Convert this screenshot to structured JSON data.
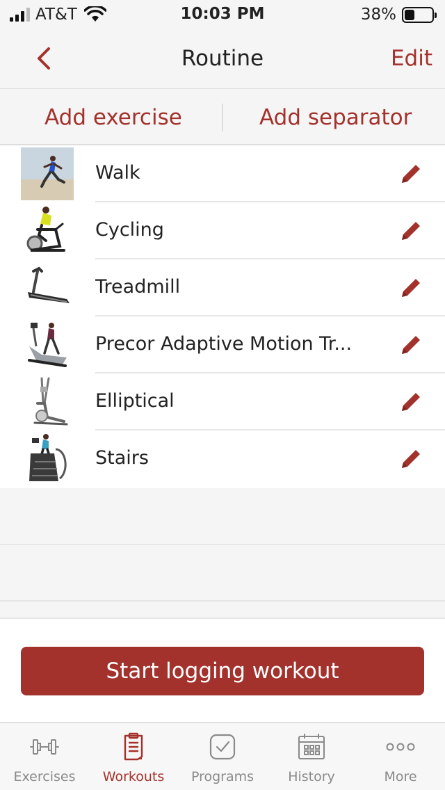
{
  "status_bar": {
    "carrier": "AT&T",
    "time": "10:03 PM",
    "battery": "38%",
    "battery_level": 0.38
  },
  "nav": {
    "title": "Routine",
    "edit_label": "Edit"
  },
  "actions": {
    "add_exercise": "Add exercise",
    "add_separator": "Add separator"
  },
  "exercises": [
    {
      "name": "Walk",
      "thumb": "runner-photo"
    },
    {
      "name": "Cycling",
      "thumb": "spin-bike-photo"
    },
    {
      "name": "Treadmill",
      "thumb": "treadmill-photo"
    },
    {
      "name": "Precor Adaptive Motion Tr...",
      "thumb": "adaptive-motion-trainer-photo"
    },
    {
      "name": "Elliptical",
      "thumb": "elliptical-photo"
    },
    {
      "name": "Stairs",
      "thumb": "stair-climber-photo"
    }
  ],
  "start_button": "Start logging workout",
  "tabs": [
    {
      "label": "Exercises",
      "icon": "dumbbell-icon"
    },
    {
      "label": "Workouts",
      "icon": "clipboard-icon"
    },
    {
      "label": "Programs",
      "icon": "checkbox-icon"
    },
    {
      "label": "History",
      "icon": "calendar-icon"
    },
    {
      "label": "More",
      "icon": "more-dots-icon"
    }
  ],
  "colors": {
    "accent": "#a3322c",
    "inactive": "#8a8a8a",
    "background": "#f5f5f5"
  }
}
